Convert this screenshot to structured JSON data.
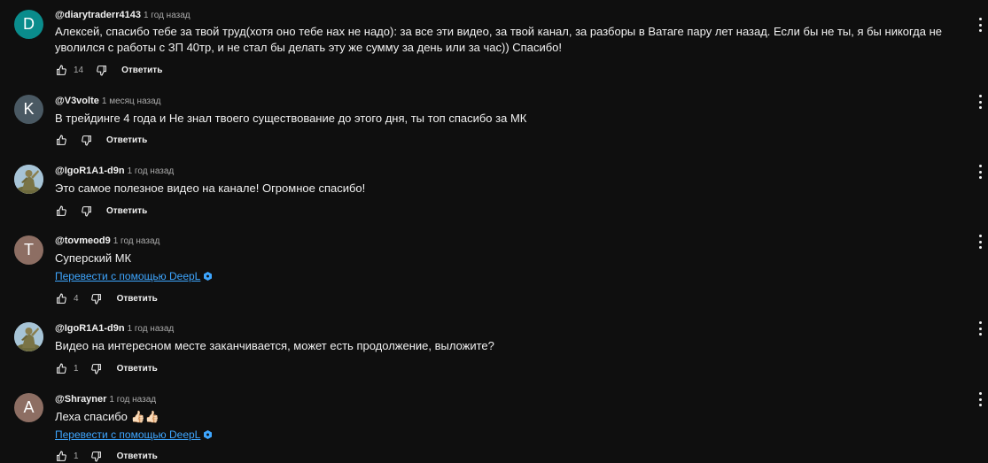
{
  "comments": [
    {
      "avatar_letter": "D",
      "avatar_color": "#0a8c8c",
      "author": "@diarytraderr4143",
      "time": "1 год назад",
      "text": "Алексей, спасибо тебе за твой труд(хотя оно тебе нах не надо): за все эти видео, за твой канал, за разборы в Ватаге пару лет назад. Если бы не ты, я бы никогда не уволился с работы с ЗП 40тр, и не стал бы делать эту же сумму за день или за час)) Спасибо!",
      "likes": "14",
      "reply_label": "Ответить"
    },
    {
      "avatar_letter": "K",
      "avatar_color": "#4a5963",
      "author": "@V3volte",
      "time": "1 месяц назад",
      "text": "В трейдинге 4 года и Не знал твоего существование до этого дня, ты топ спасибо за МК",
      "likes": "",
      "reply_label": "Ответить"
    },
    {
      "avatar_letter": "",
      "avatar_icon": "statue-avatar-image",
      "author": "@IgoR1A1-d9n",
      "time": "1 год назад",
      "text": "Это самое полезное видео на канале! Огромное спасибо!",
      "likes": "",
      "reply_label": "Ответить"
    },
    {
      "avatar_letter": "T",
      "avatar_color": "#8d6e63",
      "author": "@tovmeod9",
      "time": "1 год назад",
      "text": "Суперский МК",
      "translate_label": "Перевести с помощью DeepL",
      "likes": "4",
      "reply_label": "Ответить"
    },
    {
      "avatar_letter": "",
      "avatar_icon": "statue-avatar-image",
      "author": "@IgoR1A1-d9n",
      "time": "1 год назад",
      "text": "Видео на интересном месте заканчивается, может есть продолжение, выложите?",
      "likes": "1",
      "reply_label": "Ответить"
    },
    {
      "avatar_letter": "A",
      "avatar_color": "#8d6e63",
      "author": "@Shrayner",
      "time": "1 год назад",
      "text": "Леха спасибо 👍🏻👍🏻",
      "translate_label": "Перевести с помощью DeepL",
      "likes": "1",
      "reply_label": "Ответить"
    }
  ],
  "icons": {
    "like": "thumbs-up-icon",
    "dislike": "thumbs-down-icon",
    "more": "more-vert-icon",
    "deepl": "deepl-icon"
  },
  "colors": {
    "background": "#0f0f0f",
    "text": "#f1f1f1",
    "secondary": "#aaaaaa",
    "link": "#3ea6ff"
  }
}
